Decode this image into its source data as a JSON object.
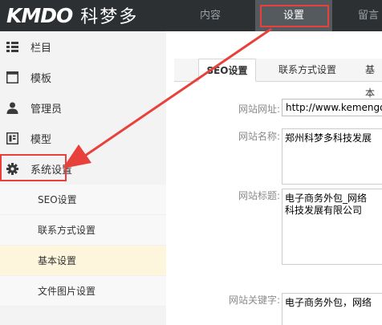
{
  "brand": {
    "logo_en": "KMDO",
    "logo_cn": "科梦多"
  },
  "topnav": {
    "items": [
      {
        "label": "内容"
      },
      {
        "label": "设置"
      },
      {
        "label": "留言"
      }
    ],
    "active_index": 1
  },
  "sidebar": {
    "items": [
      {
        "label": "栏目",
        "icon": "list-icon"
      },
      {
        "label": "模板",
        "icon": "template-icon"
      },
      {
        "label": "管理员",
        "icon": "user-icon"
      },
      {
        "label": "模型",
        "icon": "model-icon"
      },
      {
        "label": "系统设置",
        "icon": "gear-icon"
      }
    ],
    "subitems": [
      {
        "label": "SEO设置"
      },
      {
        "label": "联系方式设置"
      },
      {
        "label": "基本设置"
      },
      {
        "label": "文件图片设置"
      }
    ]
  },
  "tabs": [
    {
      "label": "SEO设置"
    },
    {
      "label": "联系方式设置"
    },
    {
      "label": "基本"
    }
  ],
  "form": {
    "site_url_label": "网站网址:",
    "site_url_value": "http://www.kemengd",
    "site_name_label": "网站名称:",
    "site_name_value": "郑州科梦多科技发展",
    "site_title_label": "网站标题:",
    "site_title_value": "电子商务外包_网络",
    "site_title_value2": "科技发展有限公司",
    "site_keywords_label": "网站关键字:",
    "site_keywords_value": "电子商务外包，网络"
  },
  "colors": {
    "topbar": "#2c3033",
    "highlight_red": "#e8403a",
    "active_sub": "#fdf6dc"
  }
}
